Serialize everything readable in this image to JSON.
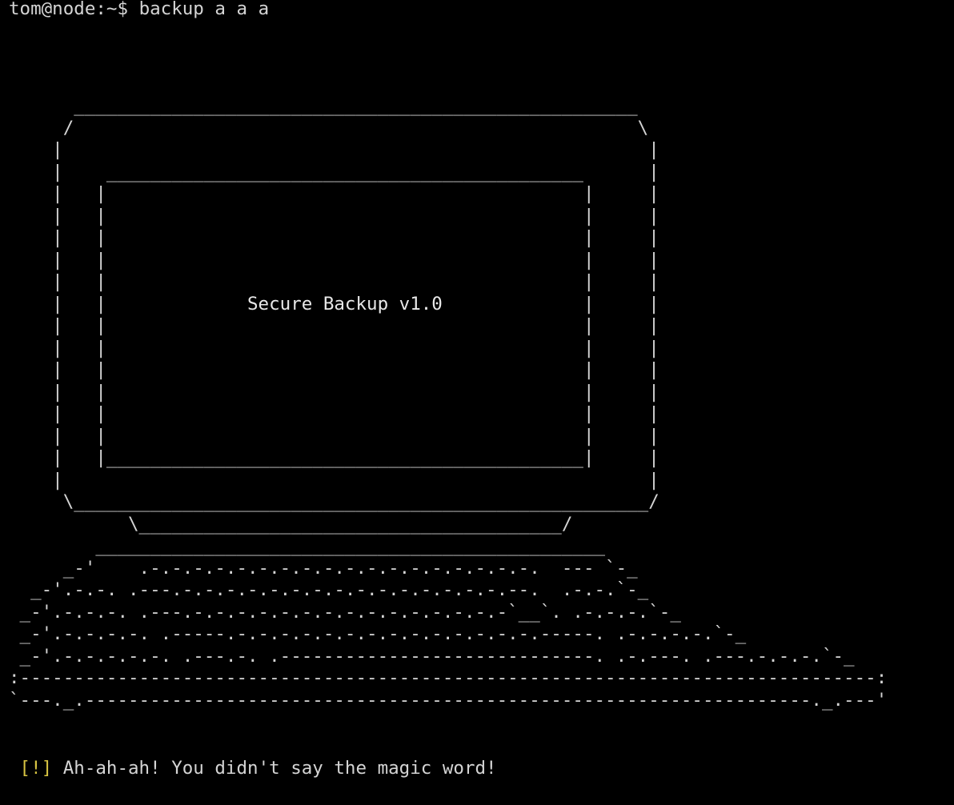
{
  "terminal": {
    "prompt": "tom@node:~$",
    "command": "backup a a a",
    "art_title": "Secure Backup v1.0",
    "message_prefix": "[!]",
    "message_text": "Ah-ah-ah! You didn't say the magic word!",
    "colors": {
      "background": "#000000",
      "foreground": "#d4d4d4",
      "warning": "#d7c342"
    }
  }
}
